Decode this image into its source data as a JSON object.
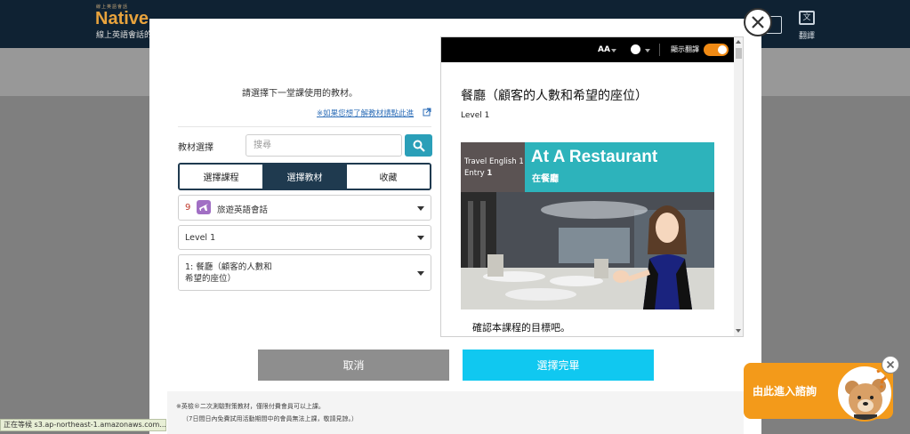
{
  "header": {
    "logo_small": "線上英語會話",
    "logo": "Native",
    "logo_sub": "線上英語會話的",
    "translate_label": "翻譯",
    "translate_icon": "translate-icon"
  },
  "modal": {
    "instruction": "請選擇下一堂課使用的教材。",
    "help_link": "※如果您想了解教材請點此進",
    "material_label": "教材選擇",
    "search_placeholder": "搜尋",
    "tabs": [
      "選擇課程",
      "選擇教材",
      "收藏"
    ],
    "active_tab": 1,
    "course_number": "9",
    "course_name": "旅遊英語會話",
    "level": "Level 1",
    "lesson_line1": "1: 餐廳（顧客的人數和",
    "lesson_line2": "希望的座位）",
    "cancel_label": "取消",
    "confirm_label": "選擇完畢",
    "note1": "※英檢®二次測驗對策教材，僅限付費會員可以上課。",
    "note2": "（7日間日內免費試用活動期間中的會員無法上課，敬請見諒。）"
  },
  "preview": {
    "font_size_label": "AA",
    "translate_toggle_label": "顯示翻譯",
    "translate_on": true,
    "title": "餐廳（顧客的人數和希望的座位）",
    "level": "Level 1",
    "banner_course": "Travel English 1",
    "banner_entry_prefix": "Entry",
    "banner_entry_num": "1",
    "banner_title": "At A Restaurant",
    "banner_subtitle": "在餐廳",
    "goal": "確認本課程的目標吧。"
  },
  "consult": {
    "label": "由此進入諮詢"
  },
  "status": {
    "text": "正在等候 s3.ap-northeast-1.amazonaws.com..."
  },
  "colors": {
    "navy": "#1f3a4f",
    "accent_cyan": "#10c8f0",
    "teal": "#2db3bb",
    "orange": "#f39a1a"
  }
}
